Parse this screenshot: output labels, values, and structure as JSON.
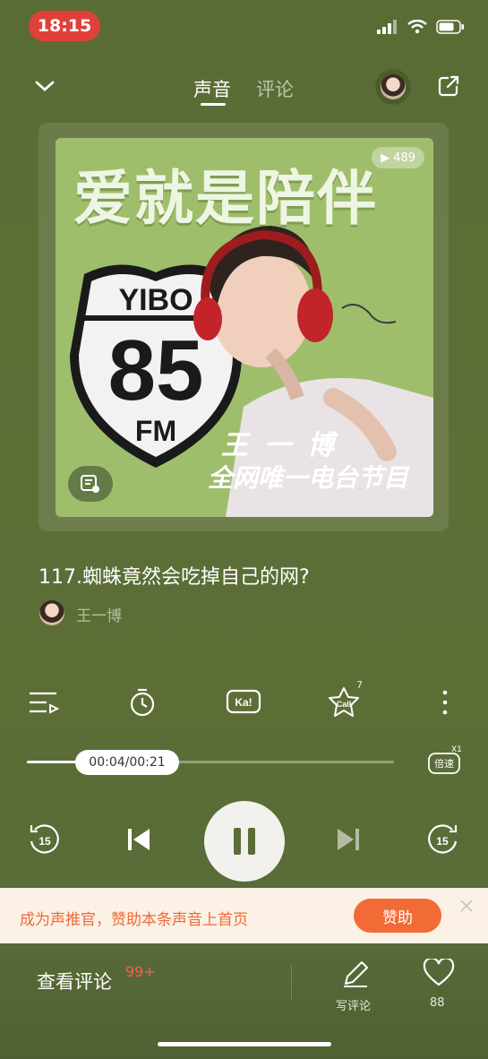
{
  "status_bar": {
    "time": "18:15"
  },
  "header": {
    "tabs": [
      {
        "label": "声音"
      },
      {
        "label": "评论"
      }
    ],
    "active_tab": "声音"
  },
  "cover": {
    "title": "爱就是陪伴",
    "play_count": "489",
    "shield_top": "YIBO",
    "shield_number": "85",
    "shield_bottom": "FM",
    "name": "王一博",
    "subtitle": "全网唯一电台节目"
  },
  "episode": {
    "title": "117.蜘蛛竟然会吃掉自己的网?",
    "author": "王一博"
  },
  "tools": {
    "call_count": "7",
    "icons": [
      "playlist-icon",
      "timer-icon",
      "karaoke-icon",
      "call-icon",
      "more-icon"
    ]
  },
  "progress": {
    "time_text": "00:04/00:21",
    "fraction": 0.19,
    "speed_label": "倍速",
    "speed_value": "X1"
  },
  "playback": {
    "rewind_label": "15",
    "forward_label": "15"
  },
  "promo": {
    "text": "成为声推官，赞助本条声音上首页",
    "button": "赞助"
  },
  "bottom": {
    "view_comments": "查看评论",
    "comment_count": "99+",
    "write_comment": "写评论",
    "likes": "88"
  },
  "colors": {
    "background": "#5b6d36",
    "accent": "#f26a35",
    "time_pill": "#e0403a",
    "cover": "#9fbe6c"
  }
}
